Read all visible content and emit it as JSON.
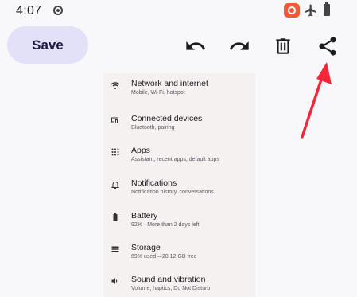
{
  "status_bar": {
    "time": "4:07",
    "icons": [
      "settings-dot-icon",
      "screen-record-icon",
      "airplane-mode-icon",
      "battery-icon"
    ],
    "record_color": "#f05a3a"
  },
  "toolbar": {
    "save_label": "Save",
    "actions": [
      "undo-icon",
      "redo-icon",
      "delete-icon",
      "share-icon"
    ],
    "save_bg": "#e3e1f8"
  },
  "settings_preview": {
    "items": [
      {
        "title": "Network and internet",
        "subtitle": "Mobile, Wi-Fi, hotspot",
        "icon": "wifi-icon"
      },
      {
        "title": "Connected devices",
        "subtitle": "Bluetooth, pairing",
        "icon": "connected-devices-icon"
      },
      {
        "title": "Apps",
        "subtitle": "Assistant, recent apps, default apps",
        "icon": "apps-grid-icon"
      },
      {
        "title": "Notifications",
        "subtitle": "Notification history, conversations",
        "icon": "bell-icon"
      },
      {
        "title": "Battery",
        "subtitle": "92% · More than 2 days left",
        "icon": "battery-icon"
      },
      {
        "title": "Storage",
        "subtitle": "69% used – 20.12 GB free",
        "icon": "storage-icon"
      },
      {
        "title": "Sound and vibration",
        "subtitle": "Volume, haptics, Do Not Disturb",
        "icon": "speaker-icon"
      }
    ]
  },
  "annotation": {
    "icon": "red-arrow-icon",
    "color": "#f2283a"
  }
}
